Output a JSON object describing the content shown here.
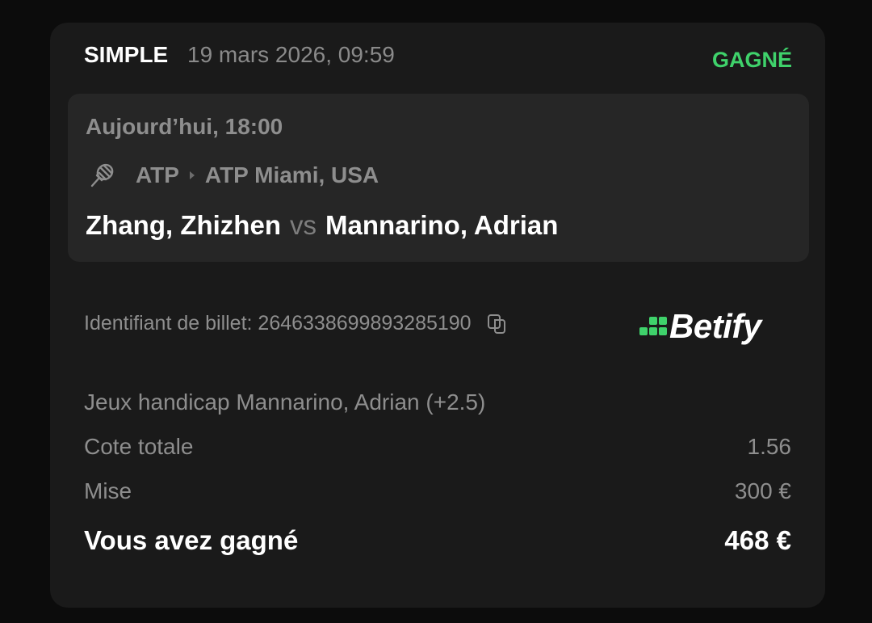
{
  "header": {
    "bet_type": "SIMPLE",
    "date": "19 mars 2026, 09:59",
    "status": "GAGNÉ"
  },
  "event": {
    "time": "Aujourd’hui, 18:00",
    "sport_icon": "tennis-racket-icon",
    "competition": "ATP",
    "tournament": "ATP Miami, USA",
    "player1": "Zhang, Zhizhen",
    "vs": "vs",
    "player2": "Mannarino, Adrian"
  },
  "ticket": {
    "label": "Identifiant de billet: 2646338699893285190",
    "copy_icon": "copy-icon"
  },
  "brand": {
    "name": "Betify",
    "accent": "#3fd26b"
  },
  "bet": {
    "description": "Jeux handicap Mannarino, Adrian (+2.5)",
    "odds_label": "Cote totale",
    "odds_value": "1.56",
    "stake_label": "Mise",
    "stake_value": "300 €",
    "win_label": "Vous avez gagné",
    "win_value": "468 €"
  },
  "colors": {
    "background": "#0c0c0c",
    "card": "#1a1a1a",
    "event_card": "#262626",
    "status_won": "#3fd26b",
    "muted_text": "#8e8e8e"
  }
}
